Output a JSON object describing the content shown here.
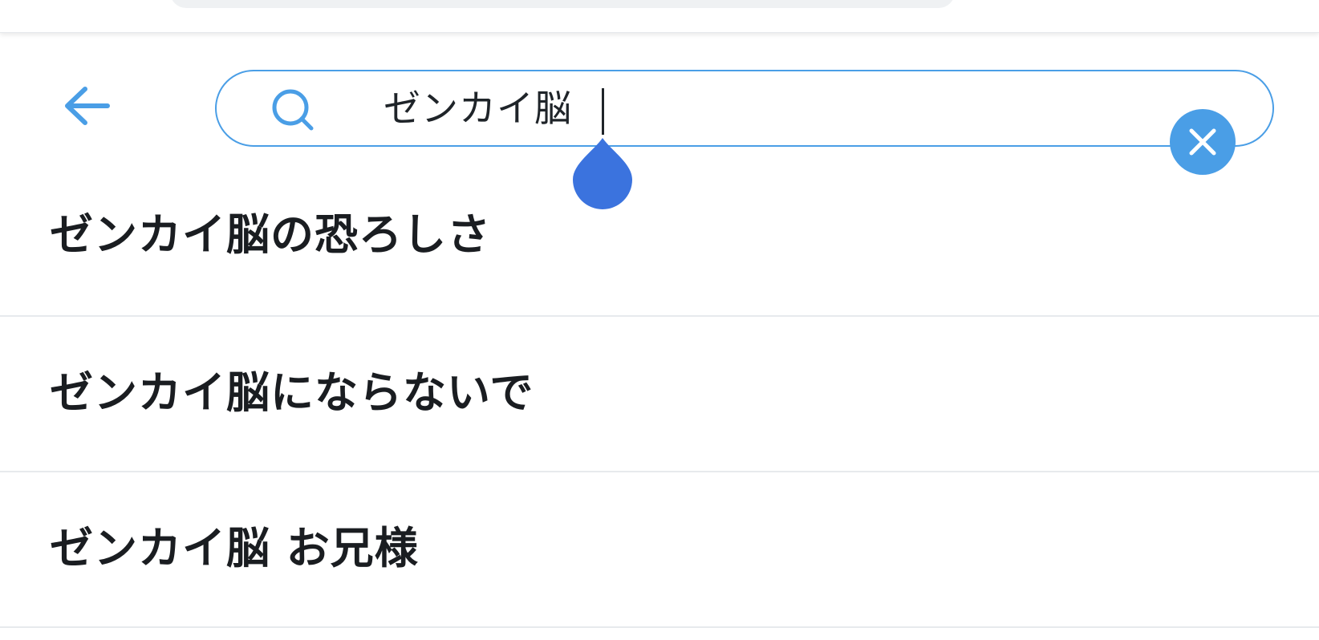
{
  "colors": {
    "accent": "#4a9ee6",
    "caret_handle": "#3b73de",
    "text_primary": "#1a1d21",
    "divider": "#e7eaed"
  },
  "header": {
    "back_icon": "arrow-left-icon",
    "search": {
      "icon": "search-icon",
      "value": "ゼンカイ脳",
      "clear_icon": "close-icon"
    }
  },
  "suggestions": [
    {
      "label": "ゼンカイ脳の恐ろしさ"
    },
    {
      "label": "ゼンカイ脳にならないで"
    },
    {
      "label": "ゼンカイ脳 お兄様"
    }
  ]
}
